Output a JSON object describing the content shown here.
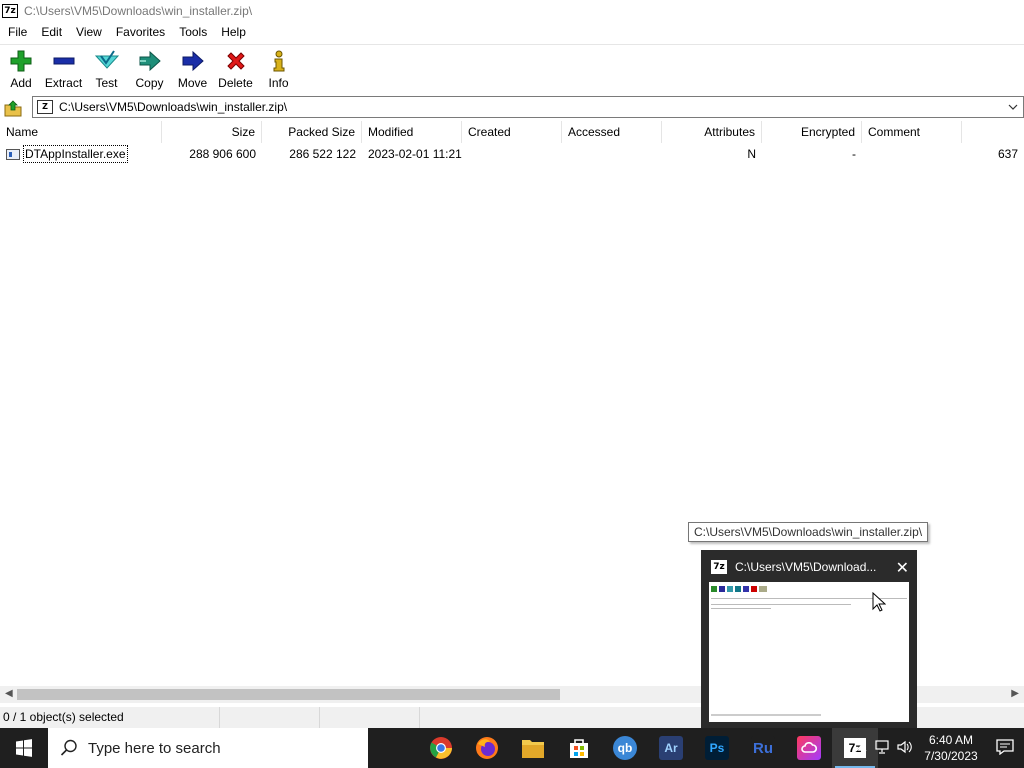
{
  "window": {
    "title": "C:\\Users\\VM5\\Downloads\\win_installer.zip\\",
    "logo": "7z"
  },
  "menu": [
    "File",
    "Edit",
    "View",
    "Favorites",
    "Tools",
    "Help"
  ],
  "toolbar": {
    "add": "Add",
    "extract": "Extract",
    "test": "Test",
    "copy": "Copy",
    "move": "Move",
    "delete": "Delete",
    "info": "Info"
  },
  "address": {
    "path": "C:\\Users\\VM5\\Downloads\\win_installer.zip\\"
  },
  "columns": {
    "name": "Name",
    "size": "Size",
    "packed": "Packed Size",
    "modified": "Modified",
    "created": "Created",
    "accessed": "Accessed",
    "attributes": "Attributes",
    "encrypted": "Encrypted",
    "comment": "Comment"
  },
  "rows": [
    {
      "name": "DTAppInstaller.exe",
      "size": "288 906 600",
      "packed": "286 522 122",
      "modified": "2023-02-01 11:21",
      "created": "",
      "accessed": "",
      "attributes": "N",
      "encrypted": "-",
      "comment": "",
      "extra": "637"
    }
  ],
  "status": {
    "selection": "0 / 1 object(s) selected"
  },
  "tooltip": "C:\\Users\\VM5\\Downloads\\win_installer.zip\\",
  "preview": {
    "title": "C:\\Users\\VM5\\Download..."
  },
  "taskbar": {
    "search_placeholder": "Type here to search",
    "apps": [
      "chrome-icon",
      "firefox-icon",
      "file-explorer-icon",
      "store-icon",
      "qbittorrent-icon",
      "illustrator-icon",
      "photoshop-icon",
      "russian-icon",
      "creative-cloud-icon",
      "7zip-icon"
    ],
    "app_labels": {
      "qb": "qb",
      "ar": "Ar",
      "ps": "Ps",
      "ru": "Ru",
      "sevenzip": "7z"
    },
    "time": "6:40 AM",
    "date": "7/30/2023"
  }
}
